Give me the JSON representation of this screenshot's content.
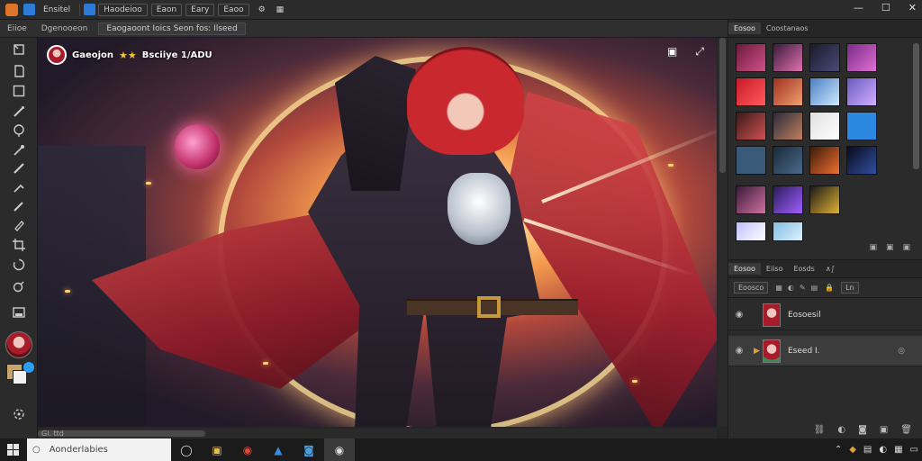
{
  "menubar": {
    "file_menu": "Ensitel",
    "app_name": "Haodeioo",
    "items": [
      "Eaon",
      "Eary",
      "Eaoo"
    ],
    "window_controls": {
      "minimize": "—",
      "maximize": "☐",
      "close": "✕"
    }
  },
  "optbar": {
    "items": [
      "Eiioe",
      "Dgenooeon"
    ],
    "tab_label": "Eaogaoont Ioics Seon fos: Ilseed"
  },
  "canvas": {
    "badge_text": "Gaeojon",
    "badge_stars": "★★",
    "badge_subtitle": "Bsciiye 1/ADU",
    "status_text": "Gl. ttd"
  },
  "swatches_panel": {
    "tabs": [
      "Eosoo",
      "Coostanaos"
    ]
  },
  "layers_panel": {
    "tabs": [
      "Eosoo",
      "Eiiso",
      "Eosds",
      "∧∫"
    ],
    "blend_label": "Eoosco",
    "opacity_label": "Ln",
    "layers": [
      {
        "name": "Eosoesil",
        "selected": false
      },
      {
        "name": "Eseed I.",
        "selected": true
      }
    ]
  },
  "taskbar": {
    "search_placeholder": "Aonderlabies"
  },
  "colors": {
    "accent": "#2d7bd6",
    "foreground_color": "#c8a56a",
    "background_color": "#f2f2f2"
  }
}
